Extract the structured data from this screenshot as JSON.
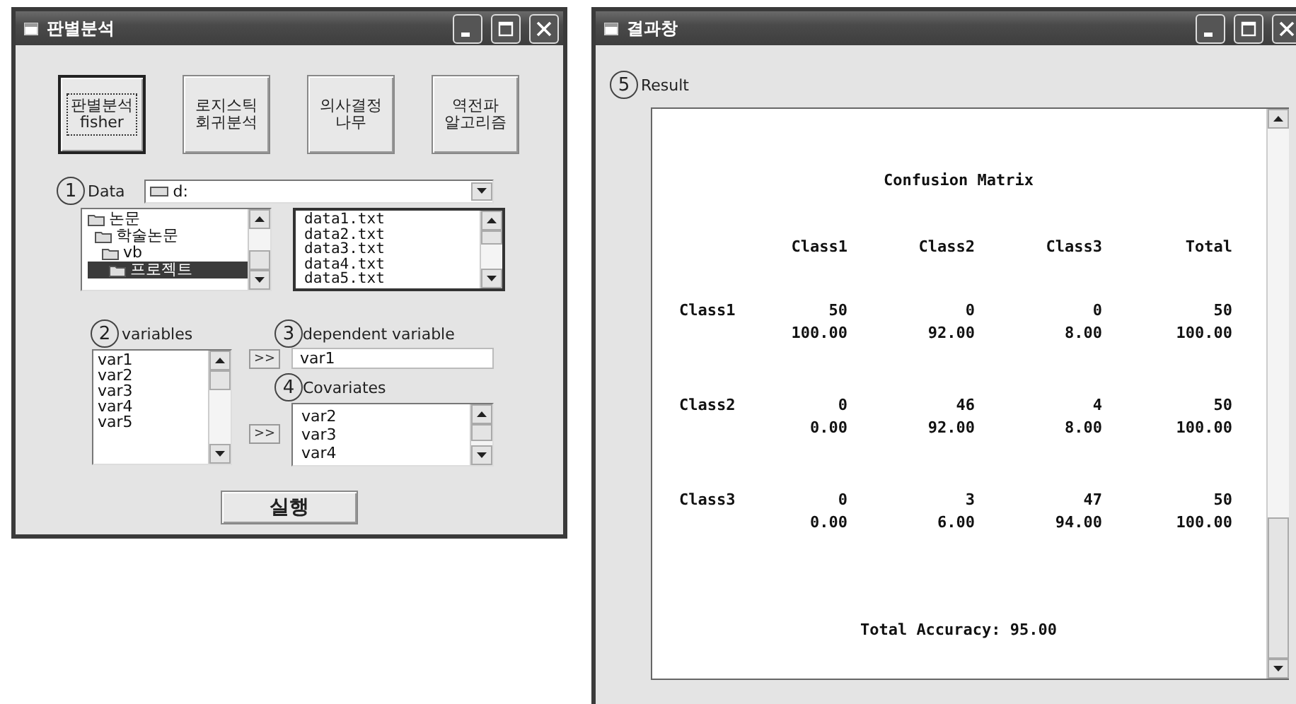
{
  "analysis_window": {
    "title": "판별분석",
    "method_buttons": [
      {
        "lines": [
          "판별분석",
          "fisher"
        ],
        "selected": true
      },
      {
        "lines": [
          "로지스틱",
          "회귀분석"
        ],
        "selected": false
      },
      {
        "lines": [
          "의사결정",
          "나무"
        ],
        "selected": false
      },
      {
        "lines": [
          "역전파",
          "알고리즘"
        ],
        "selected": false
      }
    ],
    "data": {
      "marker": "1",
      "label": "Data",
      "drive": "d:",
      "folders": [
        {
          "name": "논문",
          "selected": false,
          "children": [
            {
              "name": "학술논문",
              "selected": false,
              "children": [
                {
                  "name": "vb",
                  "selected": false,
                  "children": [
                    {
                      "name": "프로젝트",
                      "selected": true
                    }
                  ]
                }
              ]
            }
          ]
        }
      ],
      "files": [
        "data1.txt",
        "data2.txt",
        "data3.txt",
        "data4.txt",
        "data5.txt"
      ]
    },
    "variables": {
      "marker": "2",
      "label": "variables",
      "items": [
        "var1",
        "var2",
        "var3",
        "var4",
        "var5"
      ]
    },
    "dependent": {
      "marker": "3",
      "label": "dependent variable",
      "value": "var1",
      "move_button": ">>"
    },
    "covariates": {
      "marker": "4",
      "label": "Covariates",
      "items": [
        "var2",
        "var3",
        "var4"
      ],
      "move_button": ">>"
    },
    "run_button": "실행"
  },
  "result_window": {
    "title": "결과창",
    "marker": "5",
    "label": "Result",
    "heading": "Confusion Matrix",
    "columns": [
      "Class1",
      "Class2",
      "Class3",
      "Total"
    ],
    "rows": [
      {
        "label": "Class1",
        "counts": [
          "50",
          "0",
          "0",
          "50"
        ],
        "percents": [
          "100.00",
          "92.00",
          "8.00",
          "100.00"
        ]
      },
      {
        "label": "Class2",
        "counts": [
          "0",
          "46",
          "4",
          "50"
        ],
        "percents": [
          "0.00",
          "92.00",
          "8.00",
          "100.00"
        ]
      },
      {
        "label": "Class3",
        "counts": [
          "0",
          "3",
          "47",
          "50"
        ],
        "percents": [
          "0.00",
          "6.00",
          "94.00",
          "100.00"
        ]
      }
    ],
    "accuracy": "Total Accuracy: 95.00"
  }
}
